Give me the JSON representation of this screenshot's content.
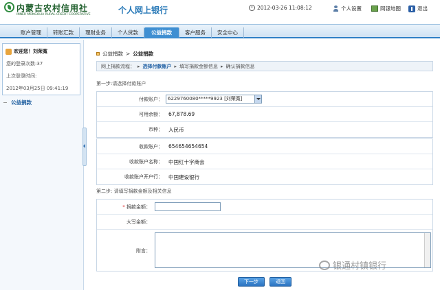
{
  "header": {
    "logo_cn": "内蒙古农村信用社",
    "logo_en": "INNER MONGOLIA RURAL CREDIT COOPERATIVE",
    "site_title": "个人网上银行",
    "datetime": "2012-03-26 11:08:12",
    "personal_settings": "个人设置",
    "site_map": "网银地图",
    "logout": "退出"
  },
  "nav": {
    "tabs": [
      {
        "label": "账户管理"
      },
      {
        "label": "转账汇款"
      },
      {
        "label": "理财业务"
      },
      {
        "label": "个人贷款"
      },
      {
        "label": "公益捐款",
        "active": true
      },
      {
        "label": "客户服务"
      },
      {
        "label": "安全中心"
      }
    ]
  },
  "sidebar": {
    "welcome": "欢迎您！刘荣寬",
    "login_count": "您的登录次数:37",
    "last_login_label": "上次登录时间:",
    "last_login_time": "2012年03月25日  09:41:19",
    "menu_item": "公益捐款"
  },
  "breadcrumb": {
    "parent": "公益捐款",
    "current": "公益捐款"
  },
  "steps": {
    "label": "网上捐款流程：",
    "items": [
      {
        "label": "选择付款账户",
        "active": true
      },
      {
        "label": "填写捐款金额信息"
      },
      {
        "label": "确认捐款信息"
      }
    ]
  },
  "section1": {
    "title": "第一步:请选择付款账户",
    "pay_account_label": "付款账户：",
    "pay_account_value": "6229760080*****9923 [刘荣寬]",
    "balance_label": "可用余额：",
    "balance_value": "67,878.69",
    "currency_label": "币种：",
    "currency_value": "人民币",
    "recv_account_label": "收款账户：",
    "recv_account_value": "654654654654",
    "recv_name_label": "收款账户名称：",
    "recv_name_value": "中国红十字商会",
    "recv_bank_label": "收款账户开户行：",
    "recv_bank_value": "中国建设银行"
  },
  "section2": {
    "title": "第二步: 请填写捐款金额及相关信息",
    "amount_label": "捐款金额：",
    "amount_value": "",
    "amount_caps_label": "大写金额：",
    "note_label": "附言：",
    "note_value": ""
  },
  "buttons": {
    "next": "下一步",
    "back": "返回"
  },
  "watermark": "银通村镇银行"
}
